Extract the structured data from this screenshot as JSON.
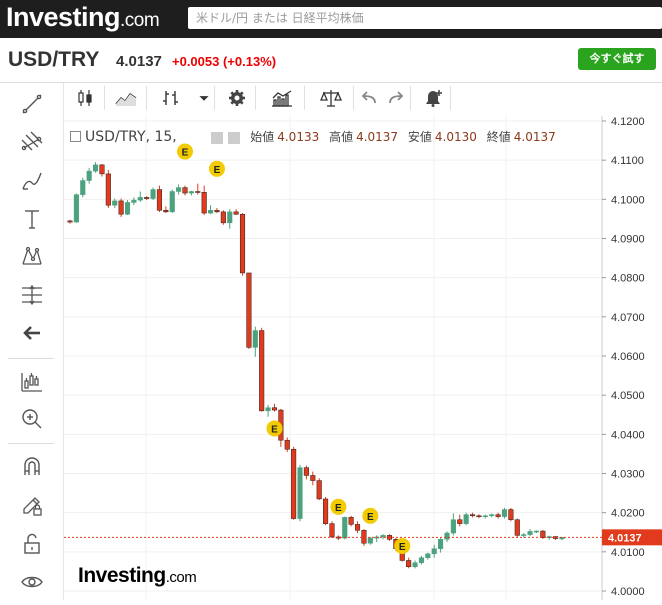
{
  "header": {
    "logo_main": "Investing",
    "logo_suffix": ".com",
    "search_placeholder": "米ドル/円 または 日経平均株価"
  },
  "quote": {
    "symbol": "USD/TRY",
    "price": "4.0137",
    "change": "+0.0053 (+0.13%)",
    "try_button": "今すぐ試す"
  },
  "left_toolbar": [
    "line-tool-icon",
    "fib-tool-icon",
    "brush-tool-icon",
    "text-tool-icon",
    "pattern-tool-icon",
    "measure-tool-icon",
    "back-arrow-icon",
    "indicators-icon",
    "zoom-icon",
    "magnet-icon",
    "draw-lock-icon",
    "unlock-icon",
    "eye-icon"
  ],
  "top_toolbar": [
    "candles-icon",
    "area-icon",
    "bars-icon",
    "dropdown-icon",
    "settings-icon",
    "indicators-icon",
    "compare-icon",
    "undo-icon",
    "redo-icon",
    "alert-icon"
  ],
  "chart_header": {
    "symbol_interval": "USD/TRY, 15,",
    "open_label": "始値",
    "open": "4.0133",
    "high_label": "高値",
    "high": "4.0137",
    "low_label": "安値",
    "low": "4.0130",
    "close_label": "終値",
    "close": "4.0137"
  },
  "watermark": {
    "main": "Investing",
    "suffix": ".com"
  },
  "colors": {
    "up": "#4ca27e",
    "down": "#e23a1c",
    "price_label": "#e23a1c",
    "event": "#f2cc00"
  },
  "chart_data": {
    "type": "candlestick",
    "yticks": [
      "4.1200",
      "4.1100",
      "4.1000",
      "4.0900",
      "4.0800",
      "4.0700",
      "4.0600",
      "4.0500",
      "4.0400",
      "4.0300",
      "4.0200",
      "4.0100",
      "4.0000"
    ],
    "ylim": [
      4.0,
      4.12
    ],
    "last_price": "4.0137",
    "last_value": 4.0137,
    "candles": [
      [
        4.0945,
        4.0948,
        4.0938,
        4.0942
      ],
      [
        4.0942,
        4.1015,
        4.094,
        4.1012
      ],
      [
        4.1012,
        4.1055,
        4.1005,
        4.1048
      ],
      [
        4.1048,
        4.108,
        4.104,
        4.1072
      ],
      [
        4.1072,
        4.1095,
        4.1068,
        4.1088
      ],
      [
        4.1088,
        4.109,
        4.1058,
        4.1065
      ],
      [
        4.1065,
        4.1075,
        4.0978,
        4.0985
      ],
      [
        4.0985,
        4.1002,
        4.0978,
        4.0996
      ],
      [
        4.0996,
        4.1002,
        4.0955,
        4.0962
      ],
      [
        4.0962,
        4.0998,
        4.096,
        4.0992
      ],
      [
        4.0992,
        4.1005,
        4.0985,
        4.0998
      ],
      [
        4.0998,
        4.102,
        4.0994,
        4.1005
      ],
      [
        4.1005,
        4.1008,
        4.0998,
        4.1002
      ],
      [
        4.1002,
        4.103,
        4.0998,
        4.1025
      ],
      [
        4.1025,
        4.1035,
        4.0968,
        4.0972
      ],
      [
        4.0972,
        4.0982,
        4.0965,
        4.0968
      ],
      [
        4.0968,
        4.1025,
        4.0965,
        4.102
      ],
      [
        4.102,
        4.1038,
        4.1012,
        4.103
      ],
      [
        4.103,
        4.1035,
        4.101,
        4.1016
      ],
      [
        4.1016,
        4.1022,
        4.101,
        4.102
      ],
      [
        4.102,
        4.104,
        4.1012,
        4.1018
      ],
      [
        4.1018,
        4.1035,
        4.096,
        4.0965
      ],
      [
        4.0965,
        4.0985,
        4.0962,
        4.0972
      ],
      [
        4.0972,
        4.0978,
        4.0965,
        4.0968
      ],
      [
        4.0968,
        4.0972,
        4.0935,
        4.094
      ],
      [
        4.094,
        4.0975,
        4.0925,
        4.0968
      ],
      [
        4.0968,
        4.0975,
        4.096,
        4.0962
      ],
      [
        4.0962,
        4.0965,
        4.0805,
        4.0812
      ],
      [
        4.0812,
        4.0812,
        4.0618,
        4.0622
      ],
      [
        4.0622,
        4.0675,
        4.0598,
        4.0665
      ],
      [
        4.0665,
        4.0672,
        4.0458,
        4.046
      ],
      [
        4.046,
        4.0475,
        4.0445,
        4.0468
      ],
      [
        4.0468,
        4.0478,
        4.0458,
        4.0462
      ],
      [
        4.0462,
        4.0465,
        4.0368,
        4.0385
      ],
      [
        4.0385,
        4.0392,
        4.0355,
        4.0362
      ],
      [
        4.0362,
        4.0368,
        4.0182,
        4.0185
      ],
      [
        4.0185,
        4.0322,
        4.0178,
        4.0315
      ],
      [
        4.0315,
        4.032,
        4.0285,
        4.0295
      ],
      [
        4.0295,
        4.0305,
        4.027,
        4.0282
      ],
      [
        4.0282,
        4.0288,
        4.0232,
        4.0235
      ],
      [
        4.0235,
        4.024,
        4.0168,
        4.0172
      ],
      [
        4.0172,
        4.0178,
        4.0135,
        4.0138
      ],
      [
        4.0138,
        4.0142,
        4.013,
        4.0135
      ],
      [
        4.0135,
        4.019,
        4.0132,
        4.0188
      ],
      [
        4.0188,
        4.0192,
        4.0165,
        4.017
      ],
      [
        4.017,
        4.0178,
        4.0148,
        4.0155
      ],
      [
        4.0155,
        4.0158,
        4.0115,
        4.0122
      ],
      [
        4.0122,
        4.0138,
        4.0118,
        4.0135
      ],
      [
        4.0135,
        4.0142,
        4.0125,
        4.0138
      ],
      [
        4.0138,
        4.0145,
        4.0132,
        4.0142
      ],
      [
        4.0142,
        4.0145,
        4.0128,
        4.0132
      ],
      [
        4.0132,
        4.0135,
        4.0102,
        4.0108
      ],
      [
        4.0108,
        4.011,
        4.0075,
        4.0078
      ],
      [
        4.0078,
        4.0085,
        4.0058,
        4.0062
      ],
      [
        4.0062,
        4.0078,
        4.0058,
        4.0072
      ],
      [
        4.0072,
        4.009,
        4.0068,
        4.0085
      ],
      [
        4.0085,
        4.0098,
        4.008,
        4.0095
      ],
      [
        4.0095,
        4.0118,
        4.0085,
        4.0108
      ],
      [
        4.0108,
        4.0135,
        4.0098,
        4.0132
      ],
      [
        4.0132,
        4.0152,
        4.0125,
        4.0148
      ],
      [
        4.0148,
        4.0198,
        4.0142,
        4.0182
      ],
      [
        4.0182,
        4.0195,
        4.0165,
        4.0172
      ],
      [
        4.0172,
        4.02,
        4.0168,
        4.0195
      ],
      [
        4.0195,
        4.02,
        4.0188,
        4.0192
      ],
      [
        4.0192,
        4.0196,
        4.0186,
        4.019
      ],
      [
        4.019,
        4.0195,
        4.0185,
        4.0192
      ],
      [
        4.0192,
        4.0198,
        4.0188,
        4.0195
      ],
      [
        4.0195,
        4.02,
        4.0185,
        4.019
      ],
      [
        4.019,
        4.0212,
        4.0185,
        4.0208
      ],
      [
        4.0208,
        4.0212,
        4.0178,
        4.0182
      ],
      [
        4.0182,
        4.0185,
        4.0138,
        4.0142
      ],
      [
        4.0142,
        4.0148,
        4.0136,
        4.0144
      ],
      [
        4.0144,
        4.0158,
        4.014,
        4.0152
      ],
      [
        4.0152,
        4.0155,
        4.0148,
        4.0153
      ],
      [
        4.0153,
        4.0156,
        4.0133,
        4.0136
      ],
      [
        4.0136,
        4.0141,
        4.0131,
        4.0139
      ],
      [
        4.0139,
        4.014,
        4.013,
        4.0134
      ],
      [
        4.0133,
        4.0137,
        4.013,
        4.0137
      ]
    ],
    "events": [
      {
        "index": 18,
        "value": 4.1122,
        "label": "E"
      },
      {
        "index": 23,
        "value": 4.1078,
        "label": "E"
      },
      {
        "index": 32,
        "value": 4.0415,
        "label": "E"
      },
      {
        "index": 42,
        "value": 4.0215,
        "label": "E"
      },
      {
        "index": 47,
        "value": 4.0192,
        "label": "E"
      },
      {
        "index": 52,
        "value": 4.0115,
        "label": "E"
      }
    ]
  }
}
